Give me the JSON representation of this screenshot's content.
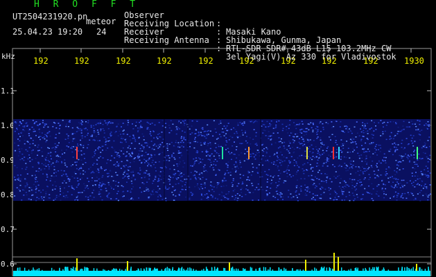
{
  "header": {
    "title": "H R O F F T",
    "filename": "UT2504231920.pn",
    "meteor_label": "meteor",
    "datetime": "25.04.23 19:20",
    "count": "24"
  },
  "meta": [
    {
      "label": "Observer",
      "value": "Masaki Kano"
    },
    {
      "label": "Receiving Location",
      "value": "Shibukawa, Gunma, Japan"
    },
    {
      "label": "Receiver",
      "value": "RTL-SDR SDR# 43dB L15 103.2MHz CW"
    },
    {
      "label": "Receiving Antenna",
      "value": "3el Yagi(V) Az 330 for Vladivostok"
    }
  ],
  "axis": {
    "unit": "kHz",
    "time_ticks": [
      "192",
      "192",
      "192",
      "192",
      "192",
      "192",
      "192",
      "192",
      "192",
      "1930"
    ],
    "freq_ticks": [
      "1.1",
      "1.0",
      "0.9",
      "0.8",
      "0.7",
      "0.6"
    ]
  },
  "colors": {
    "header_green": "#22e022",
    "tick_yellow": "#f0f000",
    "text_white": "#e8e8e8",
    "noise_blue": "#1a2ea8",
    "level_cyan": "#00e5ff"
  }
}
